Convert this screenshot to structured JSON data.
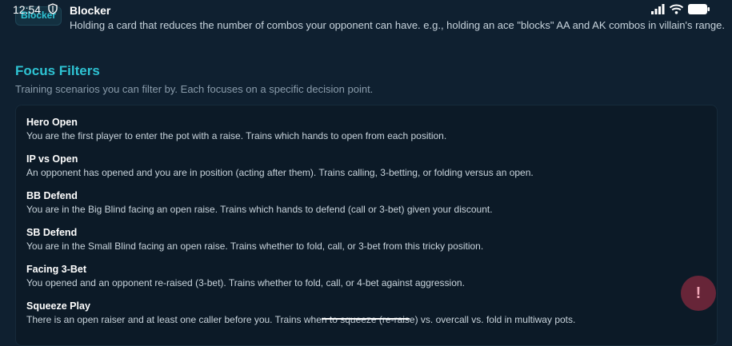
{
  "status_bar": {
    "time": "12:54"
  },
  "glossary_item": {
    "tag": "Blocker",
    "title": "Blocker",
    "description": "Holding a card that reduces the number of combos your opponent can have. e.g., holding an ace \"blocks\" AA and AK combos in villain's range."
  },
  "focus_filters": {
    "title": "Focus Filters",
    "subtitle": "Training scenarios you can filter by. Each focuses on a specific decision point.",
    "items": [
      {
        "title": "Hero Open",
        "description": "You are the first player to enter the pot with a raise. Trains which hands to open from each position."
      },
      {
        "title": "IP vs Open",
        "description": "An opponent has opened and you are in position (acting after them). Trains calling, 3-betting, or folding versus an open."
      },
      {
        "title": "BB Defend",
        "description": "You are in the Big Blind facing an open raise. Trains which hands to defend (call or 3-bet) given your discount."
      },
      {
        "title": "SB Defend",
        "description": "You are in the Small Blind facing an open raise. Trains whether to fold, call, or 3-bet from this tricky position."
      },
      {
        "title": "Facing 3-Bet",
        "description": "You opened and an opponent re-raised (3-bet). Trains whether to fold, call, or 4-bet against aggression."
      },
      {
        "title": "Squeeze Play",
        "description": "There is an open raiser and at least one caller before you. Trains when to squeeze (re-raise) vs. overcall vs. fold in multiway pots."
      }
    ]
  },
  "fab": {
    "label": "!"
  },
  "colors": {
    "background": "#0f2030",
    "accent": "#2ec3d3",
    "fab": "#78283c"
  }
}
